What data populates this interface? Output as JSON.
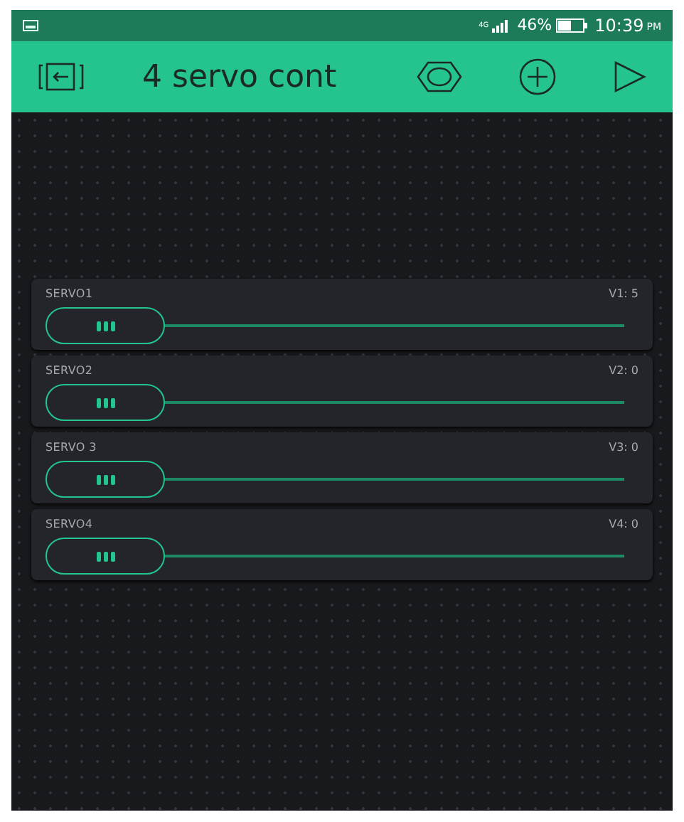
{
  "status_bar": {
    "network": "4G",
    "battery": "46%",
    "time": "10:39",
    "ampm": "PM"
  },
  "toolbar": {
    "title": "4 servo cont"
  },
  "sliders": [
    {
      "label": "SERVO1",
      "pin": "V1: 5"
    },
    {
      "label": "SERVO2",
      "pin": "V2: 0"
    },
    {
      "label": "SERVO 3",
      "pin": "V3: 0"
    },
    {
      "label": "SERVO4",
      "pin": "V4: 0"
    }
  ]
}
